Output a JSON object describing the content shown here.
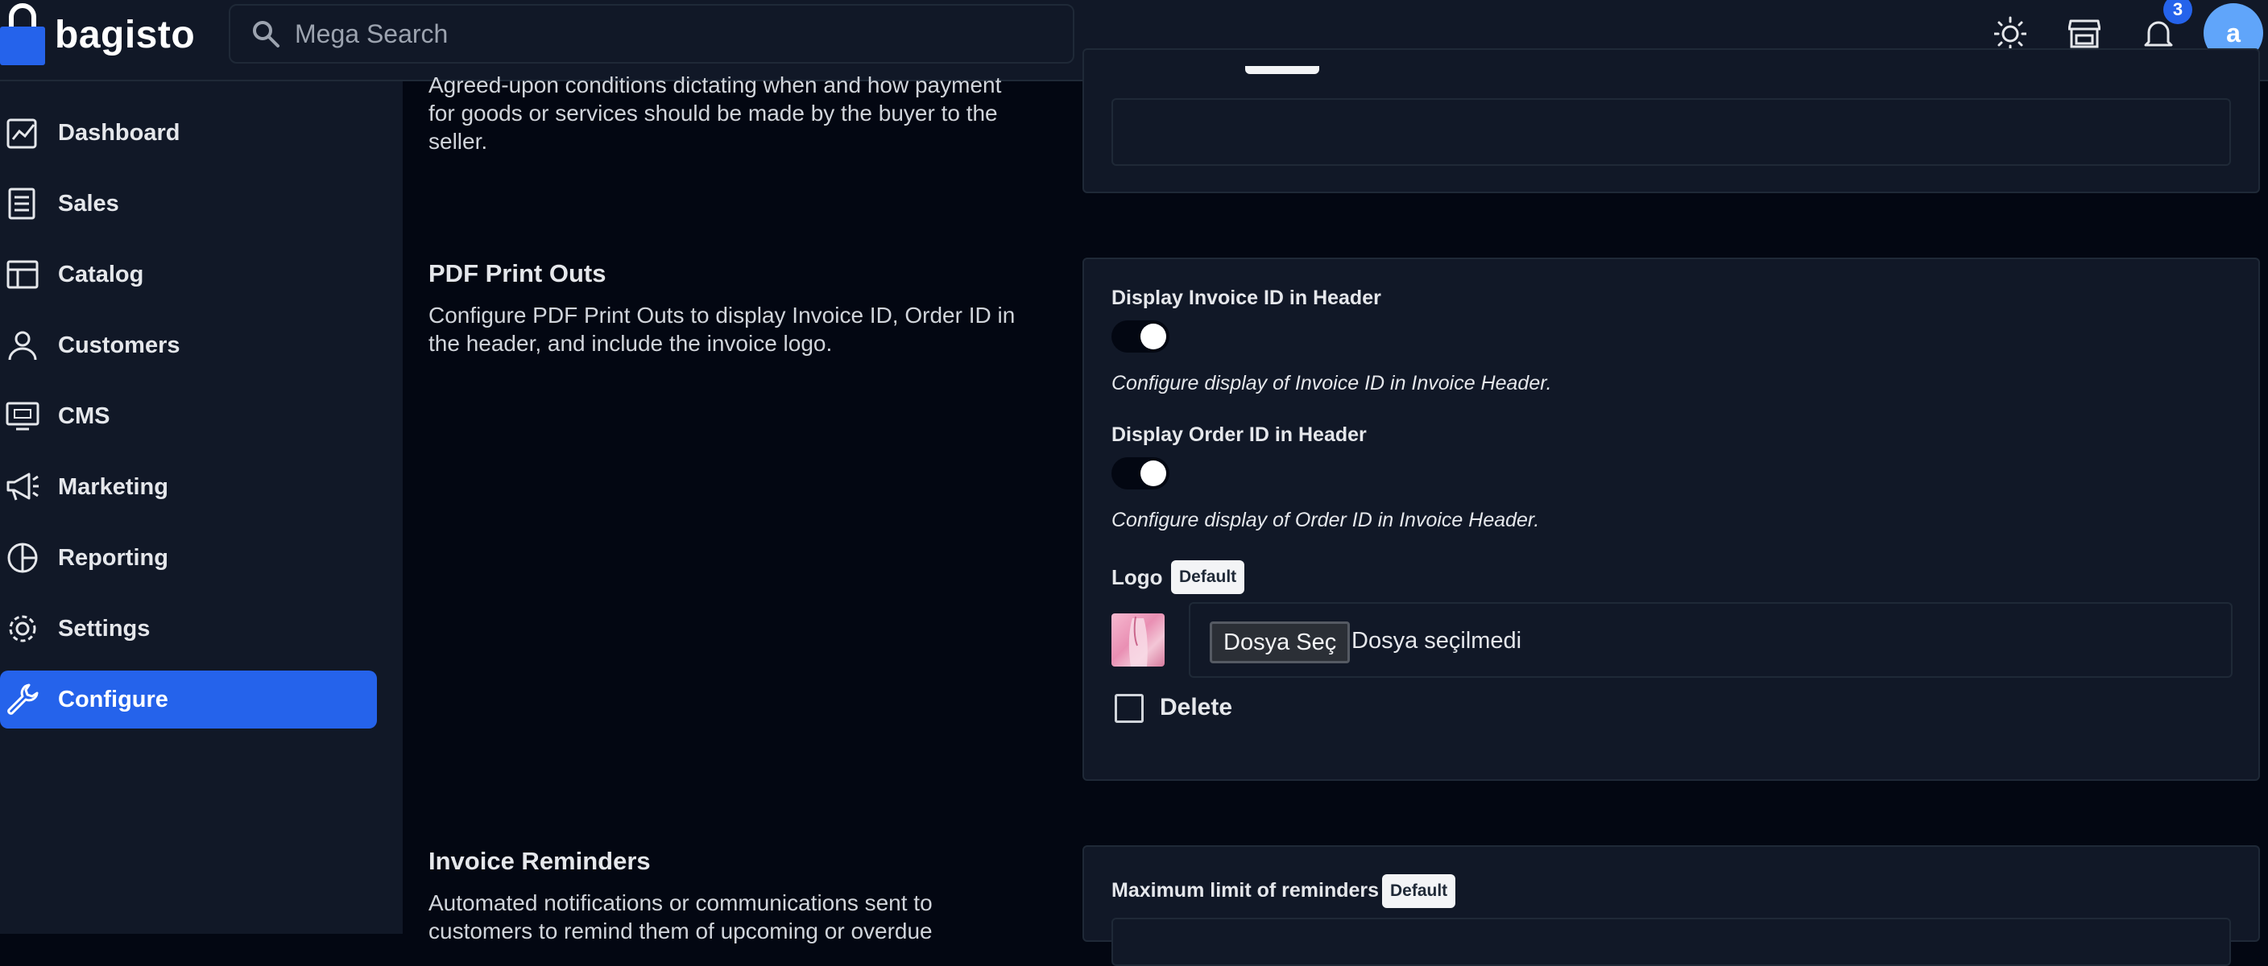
{
  "app": {
    "logo_text": "bagisto"
  },
  "search": {
    "placeholder": "Mega Search"
  },
  "header": {
    "notification_count": "3",
    "avatar_initial": "a"
  },
  "sidebar": {
    "items": [
      {
        "label": "Dashboard",
        "icon": "dashboard-icon"
      },
      {
        "label": "Sales",
        "icon": "sales-icon"
      },
      {
        "label": "Catalog",
        "icon": "catalog-icon"
      },
      {
        "label": "Customers",
        "icon": "customers-icon"
      },
      {
        "label": "CMS",
        "icon": "cms-icon"
      },
      {
        "label": "Marketing",
        "icon": "marketing-icon"
      },
      {
        "label": "Reporting",
        "icon": "reporting-icon"
      },
      {
        "label": "Settings",
        "icon": "settings-icon"
      },
      {
        "label": "Configure",
        "icon": "configure-icon",
        "active": true
      }
    ]
  },
  "sections": {
    "payment_terms": {
      "description": "Agreed-upon conditions dictating when and how payment for goods or services should be made by the buyer to the seller."
    },
    "pdf_print_outs": {
      "title": "PDF Print Outs",
      "description": "Configure PDF Print Outs to display Invoice ID, Order ID in the header, and include the invoice logo.",
      "invoice_id_label": "Display Invoice ID in Header",
      "invoice_id_enabled": true,
      "invoice_id_hint": "Configure display of Invoice ID in Invoice Header.",
      "order_id_label": "Display Order ID in Header",
      "order_id_enabled": true,
      "order_id_hint": "Configure display of Order ID in Invoice Header.",
      "logo_label": "Logo",
      "logo_badge": "Default",
      "file_button": "Dosya Seç",
      "file_status": "Dosya seçilmedi",
      "delete_label": "Delete",
      "delete_checked": false
    },
    "invoice_reminders": {
      "title": "Invoice Reminders",
      "description": "Automated notifications or communications sent to customers to remind them of upcoming or overdue",
      "max_limit_label": "Maximum limit of reminders",
      "max_limit_badge": "Default"
    }
  },
  "colors": {
    "accent": "#2563eb",
    "background": "#030712",
    "panel": "#111827",
    "border": "#1f2937"
  }
}
